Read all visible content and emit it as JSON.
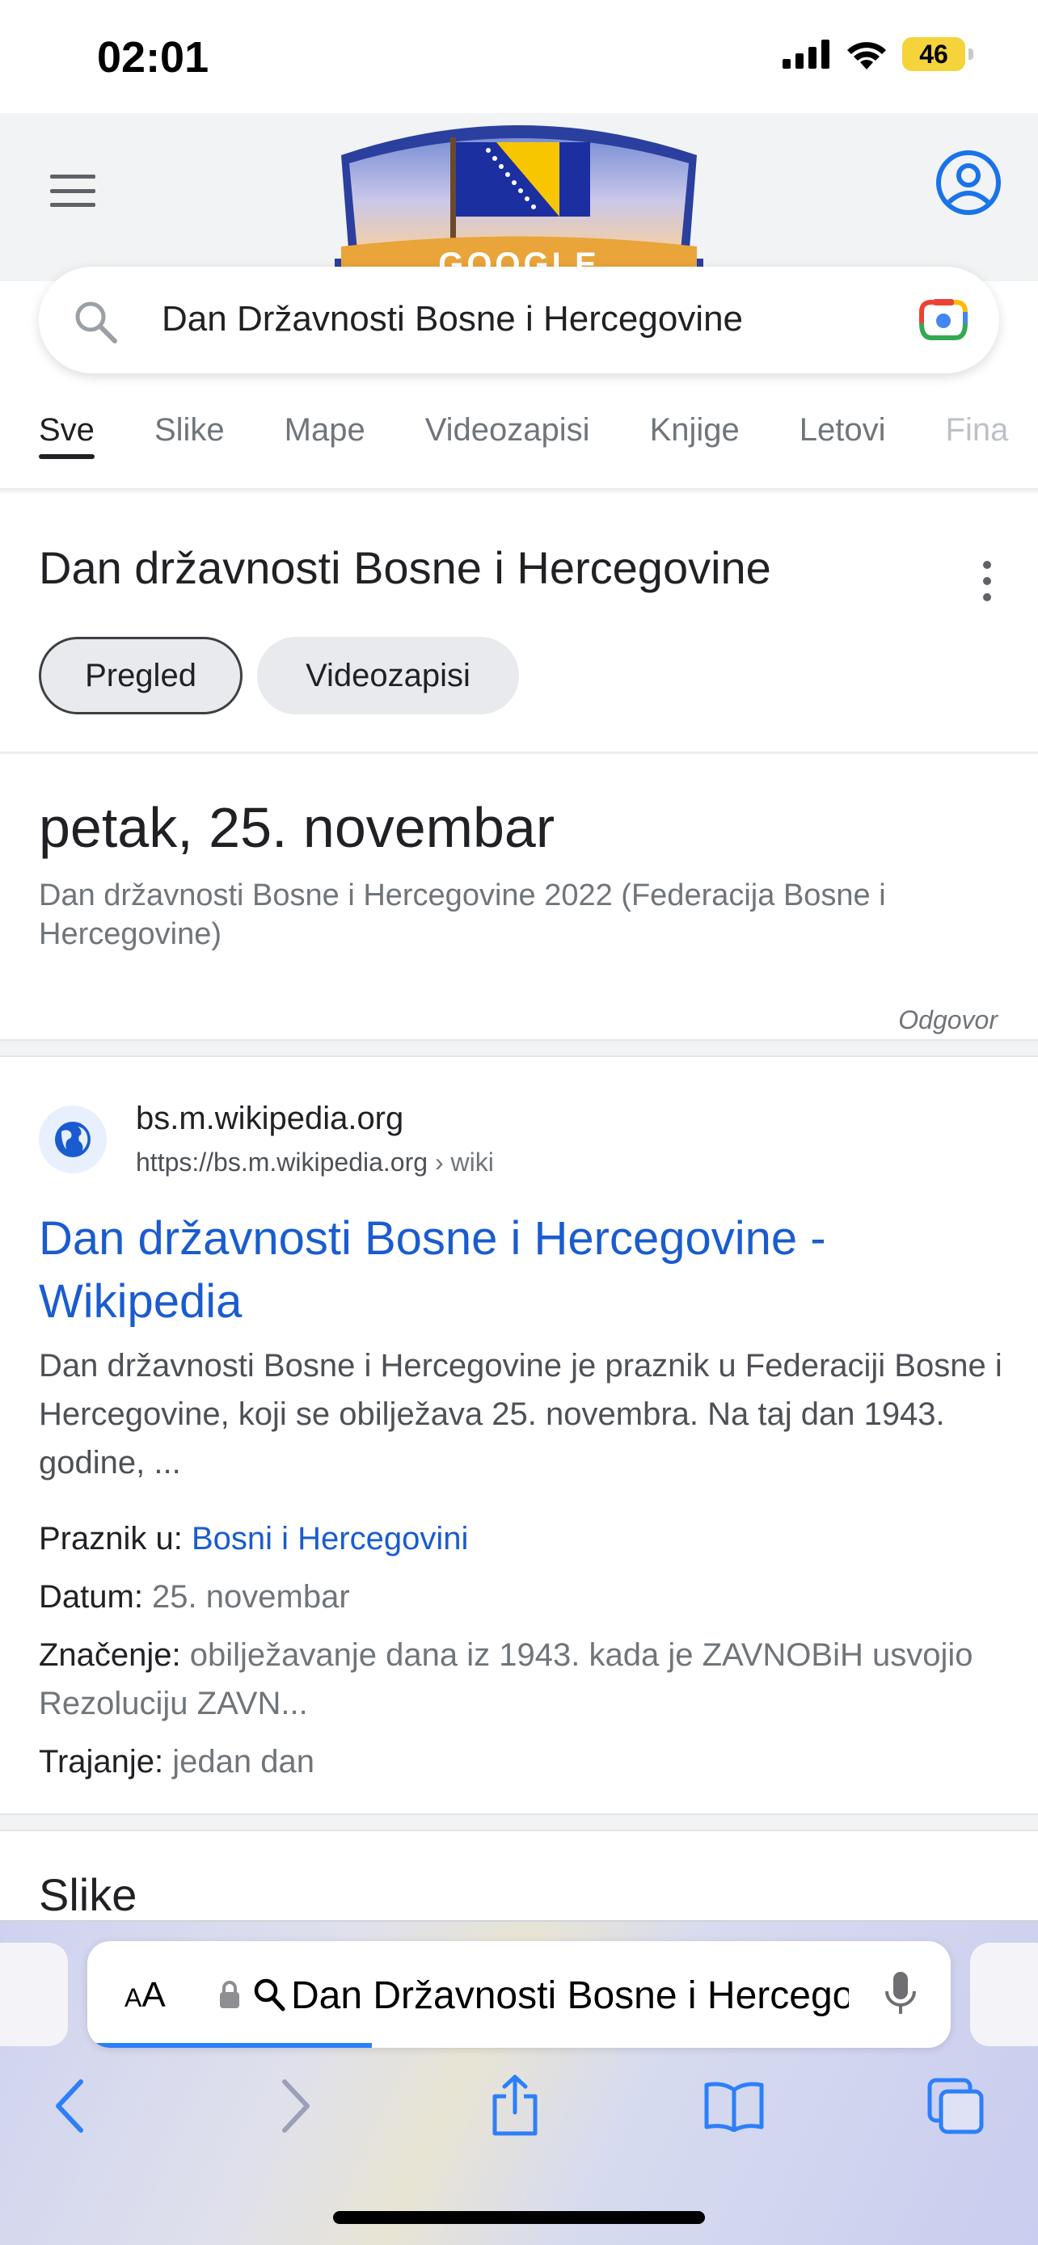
{
  "status": {
    "time": "02:01",
    "battery": "46"
  },
  "header": {
    "doodle_text": "GOOGLE"
  },
  "search": {
    "query": "Dan Državnosti Bosne i Hercegovine"
  },
  "tabs": [
    {
      "label": "Sve"
    },
    {
      "label": "Slike"
    },
    {
      "label": "Mape"
    },
    {
      "label": "Videozapisi"
    },
    {
      "label": "Knjige"
    },
    {
      "label": "Letovi"
    },
    {
      "label": "Fina"
    }
  ],
  "topic": {
    "title": "Dan državnosti Bosne i Hercegovine",
    "chips": [
      {
        "label": "Pregled"
      },
      {
        "label": "Videozapisi"
      }
    ]
  },
  "answer": {
    "date": "petak, 25. novembar",
    "subtitle": "Dan državnosti Bosne i Hercegovine 2022 (Federacija Bosne i Hercegovine)",
    "label": "Odgovor"
  },
  "result": {
    "site_name": "bs.m.wikipedia.org",
    "url": "https://bs.m.wikipedia.org",
    "url_crumb": " › wiki",
    "title": "Dan državnosti Bosne i Hercegovine - Wikipedia",
    "snippet": "Dan državnosti Bosne i Hercegovine je praznik u Federaciji Bosne i Hercegovine, koji se obilježava 25. novembra. Na taj dan 1943. godine, ...",
    "facts": [
      {
        "key": "Praznik u: ",
        "value": "Bosni i Hercegovini"
      },
      {
        "key": "Datum: ",
        "value": "25. novembar"
      },
      {
        "key": "Značenje: ",
        "value": "obilježavanje dana iz 1943. kada je ZAVNOBiH usvojio Rezoluciju ZAVN..."
      },
      {
        "key": "Trajanje: ",
        "value": "jedan dan"
      }
    ]
  },
  "images_heading": "Slike",
  "safari": {
    "aa_label": "AA",
    "url_text": "Dan Državnosti Bosne i Hercegovine",
    "load_progress": 0.33
  },
  "colors": {
    "link": "#1a5ccf",
    "flag_blue": "#1c2fa0",
    "flag_yellow": "#f7c600"
  }
}
